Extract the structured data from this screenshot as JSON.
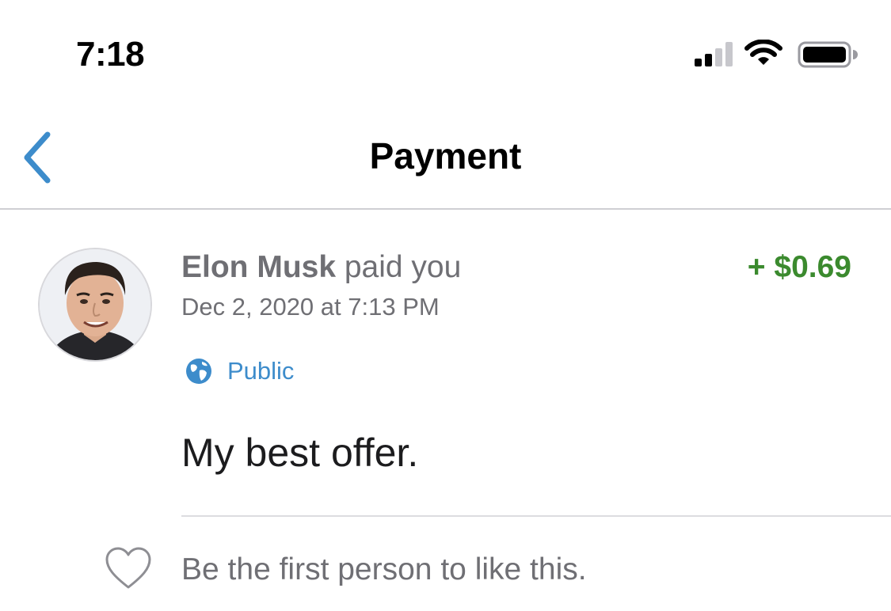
{
  "status_bar": {
    "time": "7:18",
    "icons": [
      "cellular-signal-icon",
      "wifi-icon",
      "battery-icon"
    ]
  },
  "nav": {
    "back_icon": "chevron-left-icon",
    "title": "Payment"
  },
  "payment": {
    "payer_name": "Elon Musk",
    "action": " paid you",
    "amount": "+ $0.69",
    "timestamp": "Dec 2, 2020 at 7:13 PM",
    "privacy_icon": "globe-icon",
    "privacy_label": "Public",
    "note": "My best offer."
  },
  "social": {
    "like_icon": "heart-icon",
    "like_prompt": "Be the first person to like this."
  },
  "colors": {
    "accent_blue": "#3d8ccb",
    "amount_green": "#3b8a2e",
    "secondary_text": "#6f6f74",
    "divider": "#cfcfd3"
  }
}
